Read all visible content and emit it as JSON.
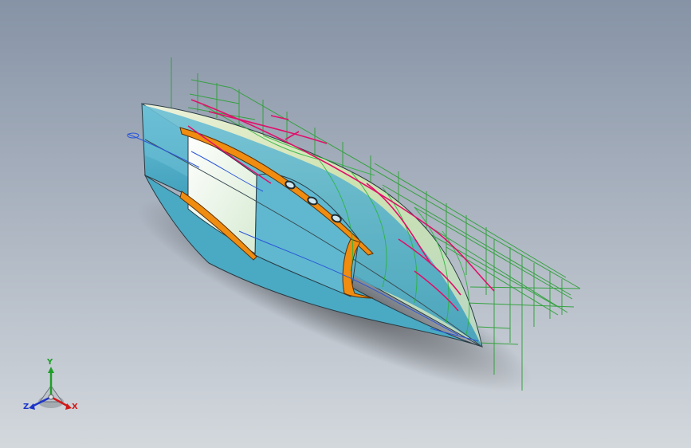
{
  "triad": {
    "y_label": "Y",
    "x_label": "X",
    "z_label": "Z",
    "colors": {
      "x": "#d11a1a",
      "y": "#1f9e2a",
      "z": "#1d34c9"
    }
  },
  "model": {
    "hull_color": "#5cb3cc",
    "accent_color": "#f08c10",
    "grid_color": "#2fa13a",
    "curve_color": "#e0106a"
  }
}
